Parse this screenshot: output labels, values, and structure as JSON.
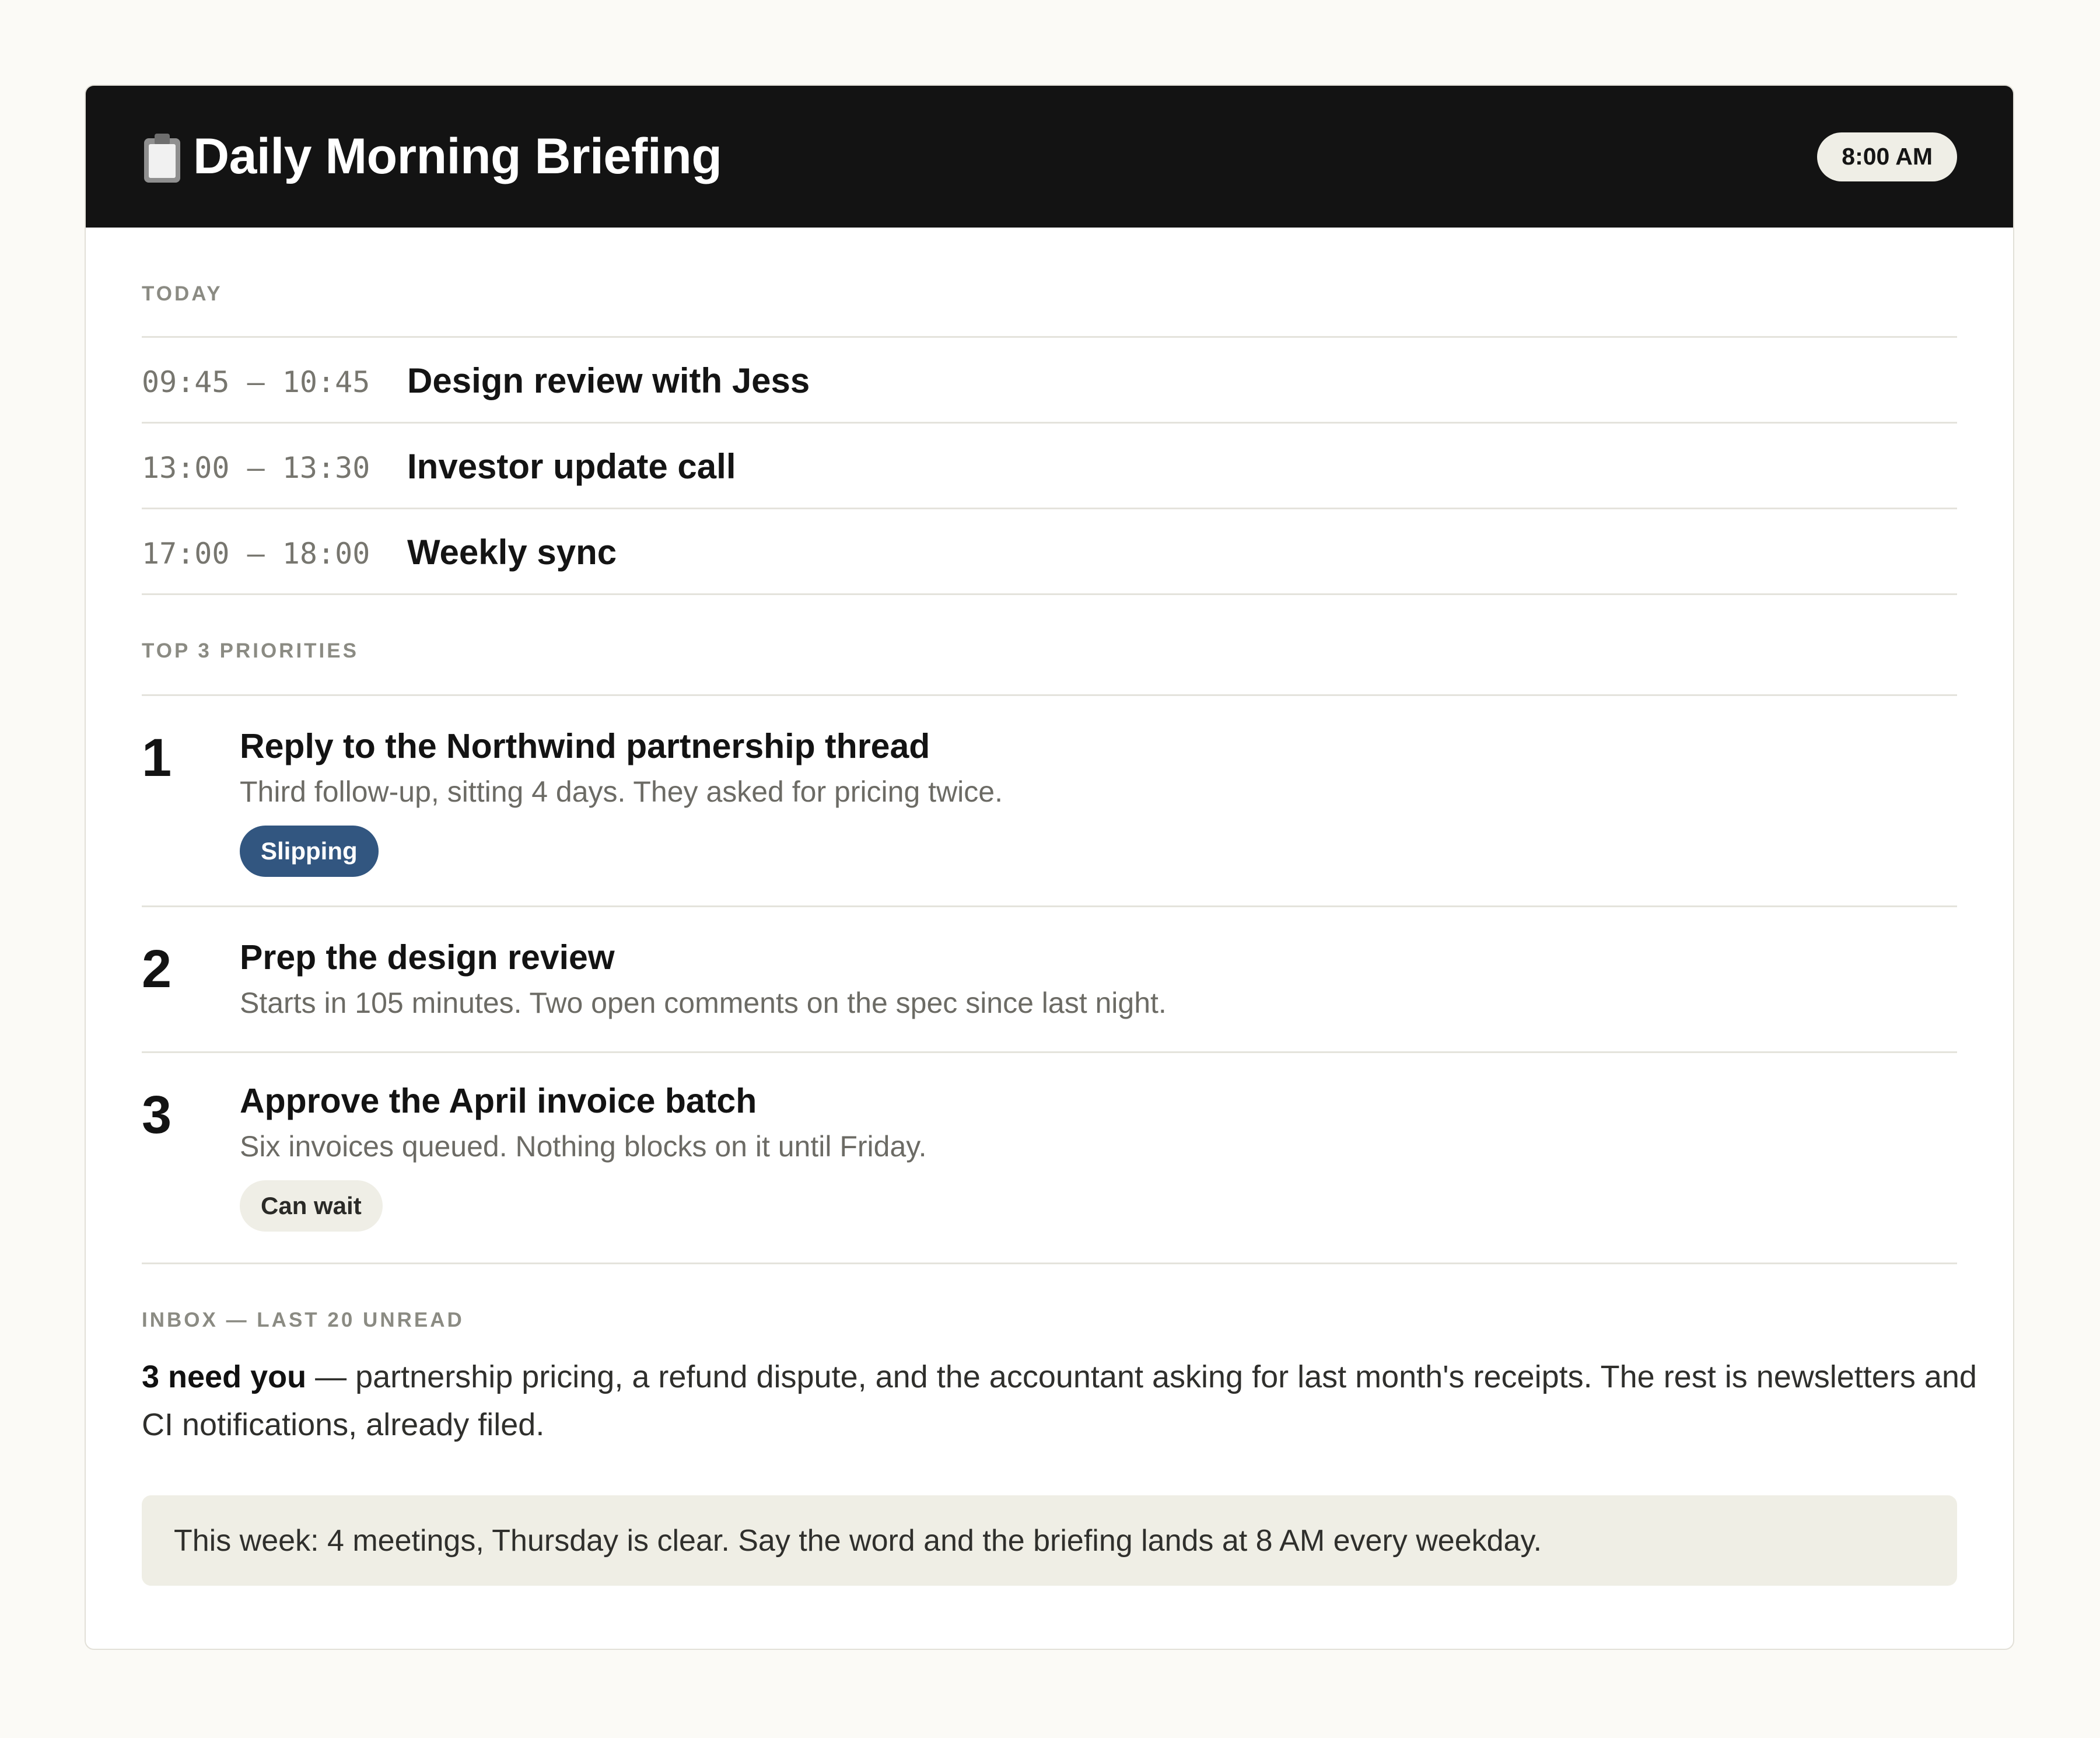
{
  "header": {
    "icon": "clipboard-icon",
    "title": "Daily Morning Briefing",
    "time": "8:00 AM"
  },
  "today": {
    "label": "TODAY",
    "events": [
      {
        "time": "09:45 — 10:45",
        "title": "Design review with Jess"
      },
      {
        "time": "13:00 — 13:30",
        "title": "Investor update call"
      },
      {
        "time": "17:00 — 18:00",
        "title": "Weekly sync"
      }
    ]
  },
  "priorities": {
    "label": "TOP 3 PRIORITIES",
    "items": [
      {
        "number": "1",
        "title": "Reply to the Northwind partnership thread",
        "description": "Third follow-up, sitting 4 days. They asked for pricing twice.",
        "badge": "Slipping"
      },
      {
        "number": "2",
        "title": "Prep the design review",
        "description": "Starts in 105 minutes. Two open comments on the spec since last night."
      },
      {
        "number": "3",
        "title": "Approve the April invoice batch",
        "description": "Six invoices queued. Nothing blocks on it until Friday.",
        "badge": "Can wait"
      }
    ]
  },
  "inbox": {
    "label": "INBOX — LAST 20 UNREAD",
    "highlight": "3 need you",
    "summary": " — partnership pricing, a refund dispute, and the accountant asking for last month's receipts. The rest is newsletters and CI notifications, already filed."
  },
  "note": {
    "text": "This week: 4 meetings, Thursday is clear. Say the word and the briefing lands at 8 AM every weekday."
  },
  "colors": {
    "header_bg": "#131313",
    "slipping_badge": "#325680",
    "neutral_badge": "#efeee6",
    "page_bg": "#fbfaf6"
  }
}
